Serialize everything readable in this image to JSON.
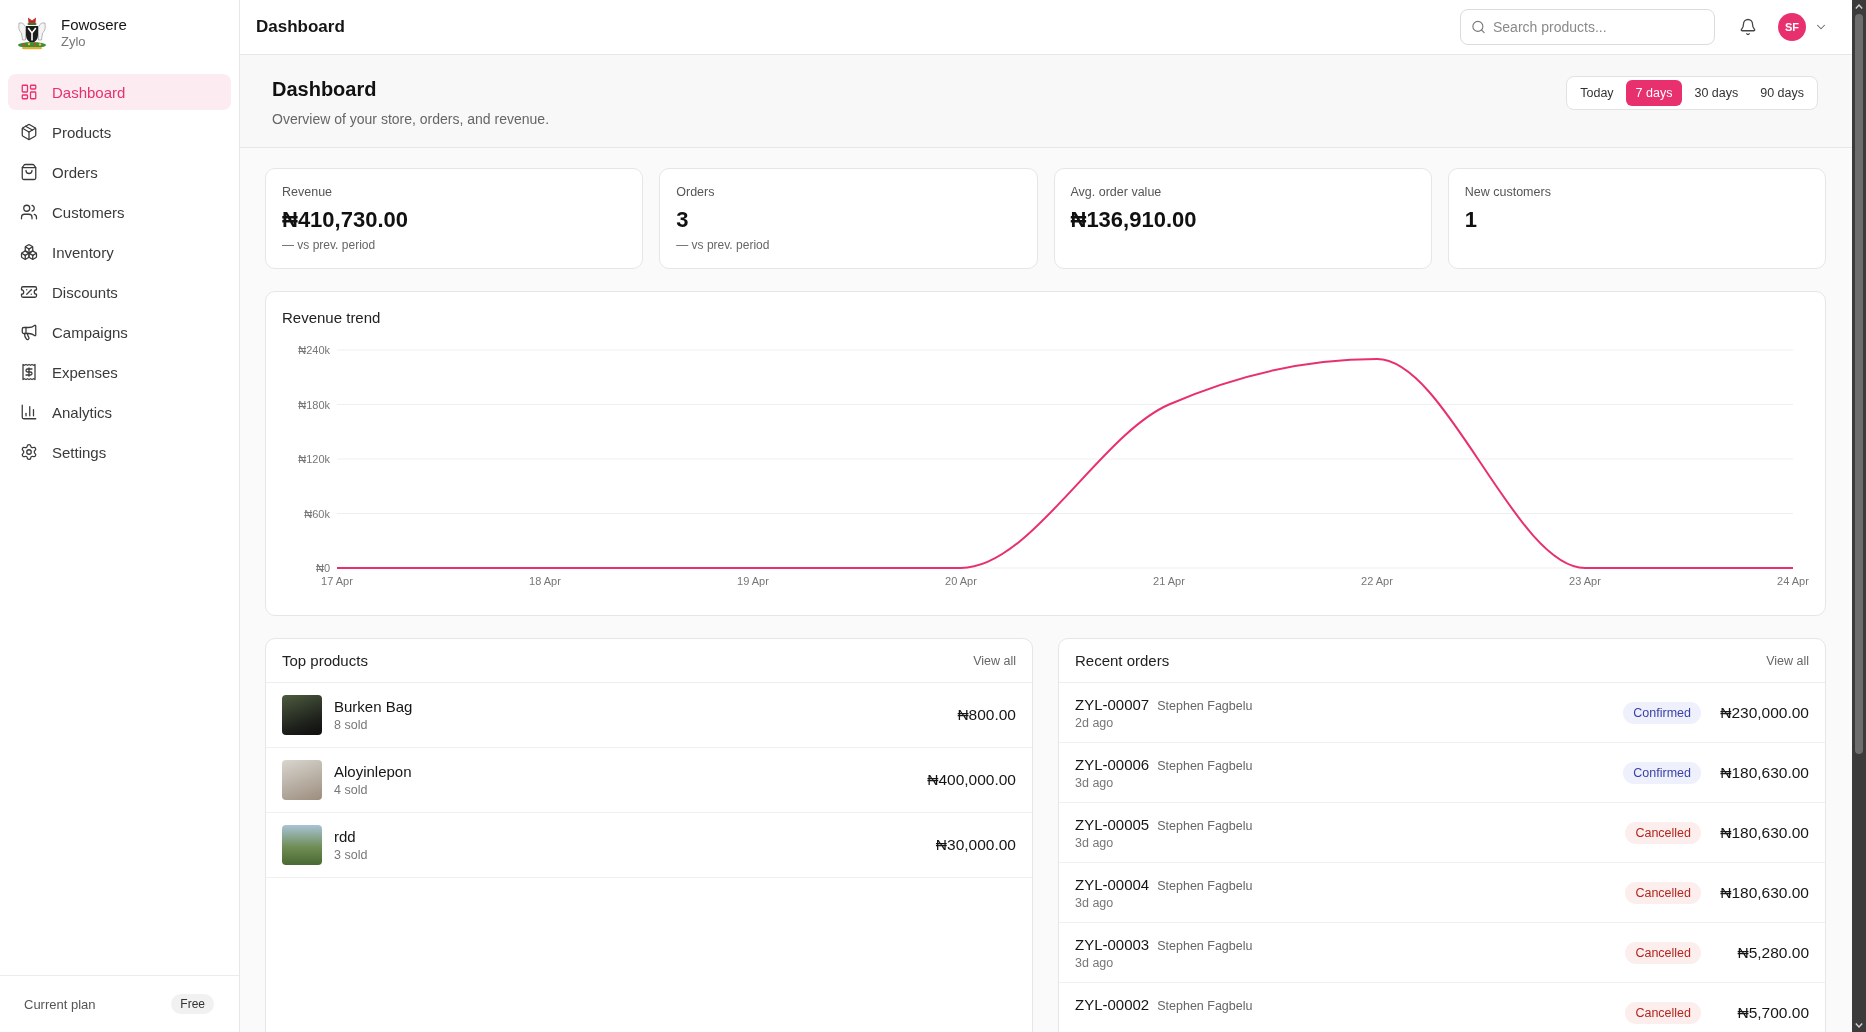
{
  "sidebar": {
    "brand": {
      "name": "Fowosere",
      "subtitle": "Zylo"
    },
    "items": [
      {
        "label": "Dashboard",
        "selected": true
      },
      {
        "label": "Products",
        "selected": false
      },
      {
        "label": "Orders",
        "selected": false
      },
      {
        "label": "Customers",
        "selected": false
      },
      {
        "label": "Inventory",
        "selected": false
      },
      {
        "label": "Discounts",
        "selected": false
      },
      {
        "label": "Campaigns",
        "selected": false
      },
      {
        "label": "Expenses",
        "selected": false
      },
      {
        "label": "Analytics",
        "selected": false
      },
      {
        "label": "Settings",
        "selected": false
      }
    ],
    "plan": {
      "label": "Current plan",
      "badge": "Free"
    }
  },
  "header": {
    "title": "Dashboard",
    "search": {
      "placeholder": "Search products..."
    },
    "avatar": "SF"
  },
  "page": {
    "title": "Dashboard",
    "subtitle": "Overview of your store, orders, and revenue.",
    "ranges": [
      {
        "label": "Today",
        "selected": false
      },
      {
        "label": "7 days",
        "selected": true
      },
      {
        "label": "30 days",
        "selected": false
      },
      {
        "label": "90 days",
        "selected": false
      }
    ]
  },
  "stats": [
    {
      "label": "Revenue",
      "value": "₦410,730.00",
      "note": "— vs prev. period"
    },
    {
      "label": "Orders",
      "value": "3",
      "note": "— vs prev. period"
    },
    {
      "label": "Avg. order value",
      "value": "₦136,910.00"
    },
    {
      "label": "New customers",
      "value": "1"
    }
  ],
  "revenue_trend": {
    "chart_data": {
      "type": "line",
      "title": "Revenue trend",
      "categories": [
        "17 Apr",
        "18 Apr",
        "19 Apr",
        "20 Apr",
        "21 Apr",
        "22 Apr",
        "23 Apr",
        "24 Apr"
      ],
      "series": [
        {
          "color": "#e8306f",
          "values": [
            0,
            0,
            0,
            0,
            180000,
            230000,
            0,
            0
          ]
        }
      ],
      "ylim": [
        0,
        240000
      ],
      "yticks": [
        {
          "value": 0,
          "label": "₦0"
        },
        {
          "value": 60000,
          "label": "₦60k"
        },
        {
          "value": 120000,
          "label": "₦120k"
        },
        {
          "value": 180000,
          "label": "₦180k"
        },
        {
          "value": 240000,
          "label": "₦240k"
        }
      ],
      "grid": true
    }
  },
  "top_products": {
    "title": "Top products",
    "link": "View all",
    "items": [
      {
        "name": "Burken Bag",
        "sold": "8 sold",
        "amount": "₦800.00"
      },
      {
        "name": "Aloyinlepon",
        "sold": "4 sold",
        "amount": "₦400,000.00"
      },
      {
        "name": "rdd",
        "sold": "3 sold",
        "amount": "₦30,000.00"
      }
    ]
  },
  "recent_orders": {
    "title": "Recent orders",
    "link": "View all",
    "items": [
      {
        "id": "ZYL-00007",
        "customer": "Stephen Fagbelu",
        "time": "2d ago",
        "status": {
          "label": "Confirmed",
          "kind": "confirmed"
        },
        "amount": "₦230,000.00"
      },
      {
        "id": "ZYL-00006",
        "customer": "Stephen Fagbelu",
        "time": "3d ago",
        "status": {
          "label": "Confirmed",
          "kind": "confirmed"
        },
        "amount": "₦180,630.00"
      },
      {
        "id": "ZYL-00005",
        "customer": "Stephen Fagbelu",
        "time": "3d ago",
        "status": {
          "label": "Cancelled",
          "kind": "cancelled"
        },
        "amount": "₦180,630.00"
      },
      {
        "id": "ZYL-00004",
        "customer": "Stephen Fagbelu",
        "time": "3d ago",
        "status": {
          "label": "Cancelled",
          "kind": "cancelled"
        },
        "amount": "₦180,630.00"
      },
      {
        "id": "ZYL-00003",
        "customer": "Stephen Fagbelu",
        "time": "3d ago",
        "status": {
          "label": "Cancelled",
          "kind": "cancelled"
        },
        "amount": "₦5,280.00"
      },
      {
        "id": "ZYL-00002",
        "customer": "Stephen Fagbelu",
        "status": {
          "label": "Cancelled",
          "kind": "cancelled"
        },
        "amount": "₦5,700.00"
      }
    ]
  }
}
